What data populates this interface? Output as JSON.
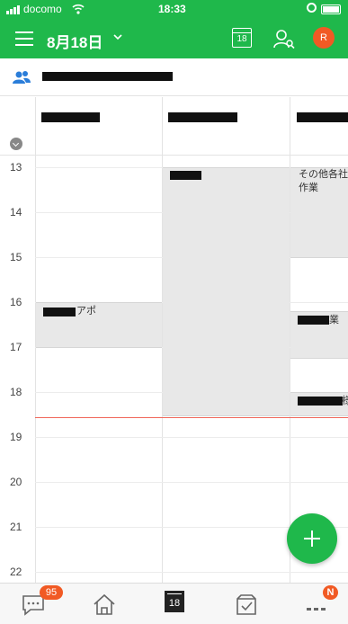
{
  "status_bar": {
    "carrier": "docomo",
    "time": "18:33"
  },
  "header": {
    "date_title": "8月18日",
    "calendar_icon_day": "18",
    "avatar_initial": "R"
  },
  "columns": [
    {
      "event_label": "アポ"
    },
    {
      "event_label": ""
    },
    {
      "event_label": "その他各社\n作業",
      "event_label_2": "業",
      "event_label_3": "様"
    }
  ],
  "hours": [
    "13",
    "14",
    "15",
    "16",
    "17",
    "18",
    "19",
    "20",
    "21",
    "22"
  ],
  "tabbar": {
    "chat_badge": "95",
    "calendar_day": "18",
    "more_badge": "N"
  },
  "colors": {
    "brand": "#1fb84b",
    "accent": "#f15a24",
    "current_time_line": "#f0675a"
  }
}
